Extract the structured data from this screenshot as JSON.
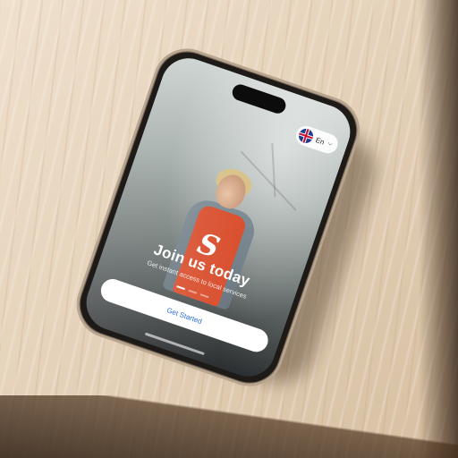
{
  "app": {
    "logo_glyph": "S",
    "title": "Join us today",
    "subtitle": "Get instant access to local services",
    "cta_label": "Get Started"
  },
  "language": {
    "selected": "En",
    "flag_icon": "uk-flag-icon",
    "chevron_icon": "chevron-down-icon"
  },
  "carousel": {
    "total": 3,
    "active_index": 0
  },
  "colors": {
    "cta_text": "#2a6de0",
    "cta_background": "#ffffff",
    "apron": "#d9502f"
  }
}
